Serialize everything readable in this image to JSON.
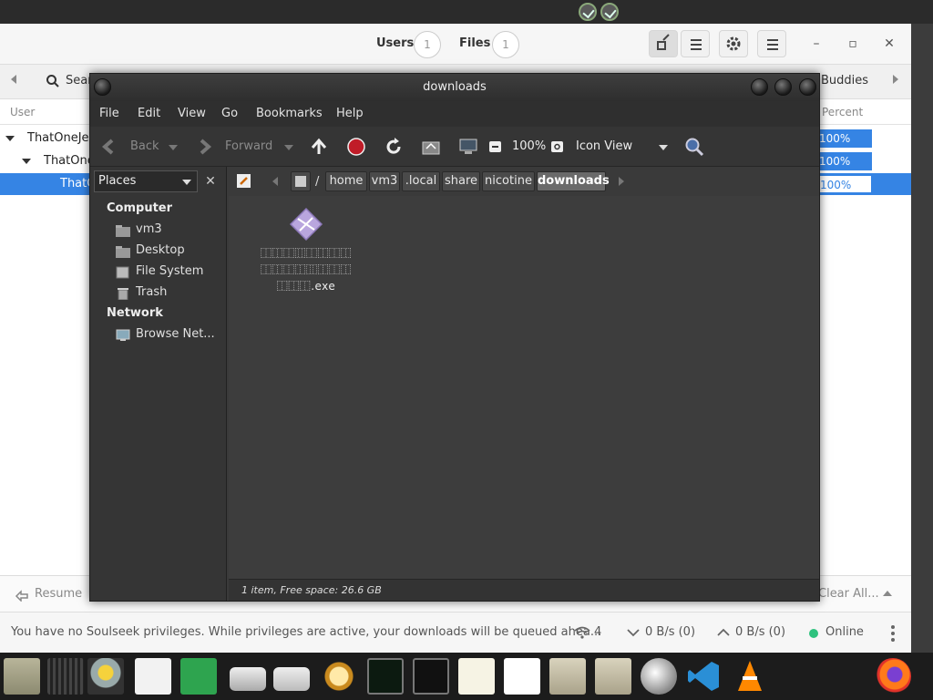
{
  "nicotine": {
    "header": {
      "users_label": "Users",
      "users_count": "1",
      "files_label": "Files",
      "files_count": "1",
      "minimize": "–",
      "maximize": "▫",
      "close": "✕"
    },
    "tabs": {
      "search": "Sear",
      "buddies": "Buddies"
    },
    "columns": {
      "user": "User",
      "percent": "Percent"
    },
    "rows": [
      {
        "label": "ThatOneJer",
        "percent": "100%"
      },
      {
        "label": "ThatOne",
        "percent": "100%"
      },
      {
        "label": "ThatO",
        "percent": "100%"
      }
    ],
    "footer": {
      "resume": "Resume",
      "clear_all": "Clear All..."
    },
    "status": {
      "message": "You have no Soulseek privileges. While privileges are active, your downloads will be queued ahea...",
      "connections": "4",
      "download_speed": "0 B/s (0)",
      "upload_speed": "0 B/s (0)",
      "online": "Online"
    }
  },
  "file_manager": {
    "title": "downloads",
    "menu": [
      "File",
      "Edit",
      "View",
      "Go",
      "Bookmarks",
      "Help"
    ],
    "toolbar": {
      "back": "Back",
      "forward": "Forward",
      "zoom": "100%",
      "view_mode": "Icon View"
    },
    "sidebar": {
      "places_label": "Places",
      "computer_header": "Computer",
      "computer_items": [
        "vm3",
        "Desktop",
        "File System",
        "Trash"
      ],
      "network_header": "Network",
      "network_items": [
        "Browse Net..."
      ]
    },
    "path": {
      "root_sep": "/",
      "crumbs": [
        "home",
        "vm3",
        ".local",
        "share",
        "nicotine",
        "downloads"
      ]
    },
    "file": {
      "name_line1": "⿰⿰⿰⿲⿰⿰⿰⿰",
      "name_line2": "⿰⿰⿰⿰⿲⿰⿰⿰",
      "name_line3": "⿰⿰⿰.exe"
    },
    "statusbar": "1 item, Free space: 26.6 GB"
  },
  "colors": {
    "accent": "#3584e4",
    "online": "#2ec27e",
    "fm_bg": "#3a3a3a"
  }
}
